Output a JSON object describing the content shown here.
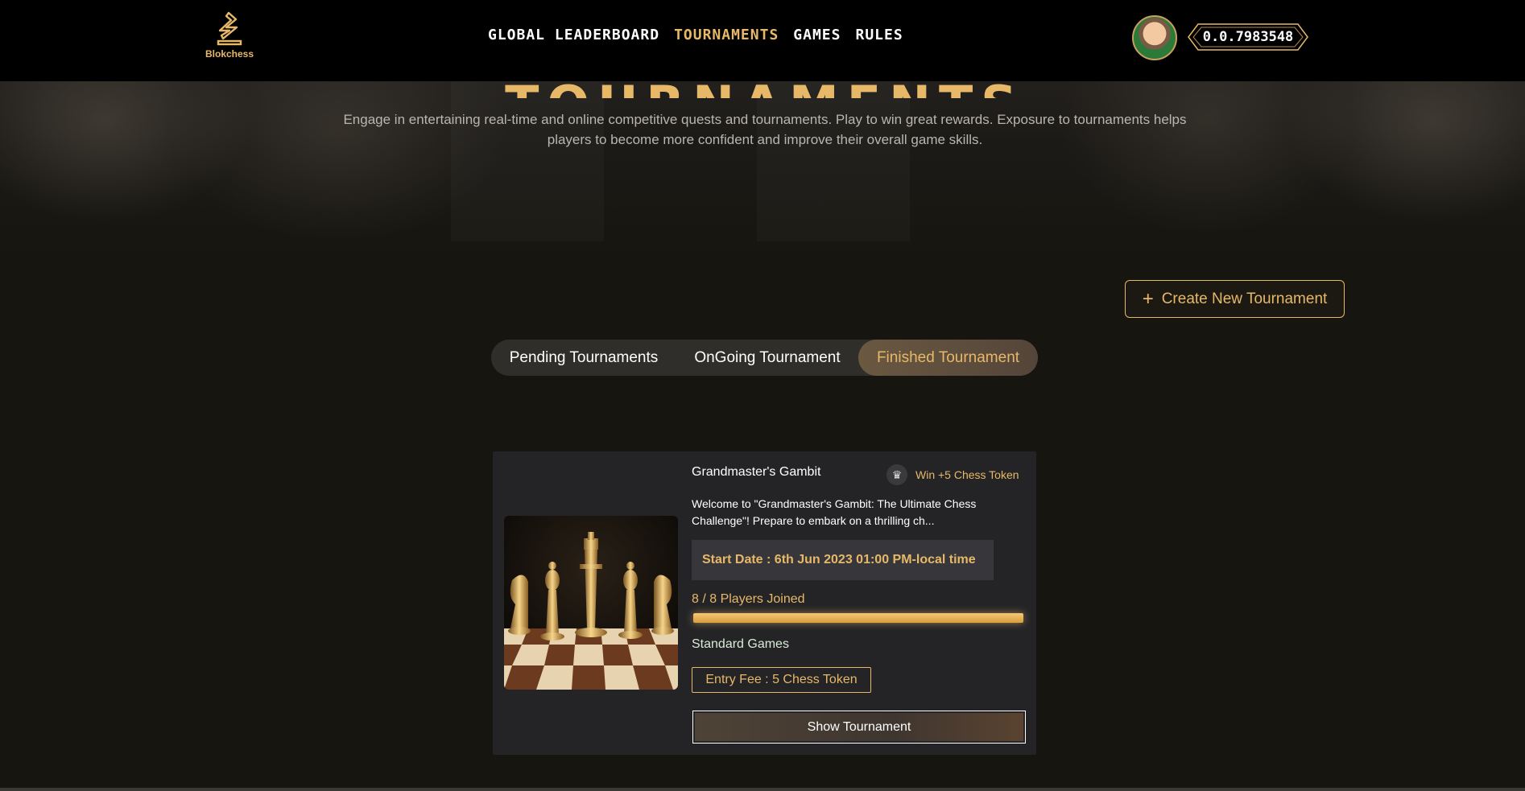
{
  "brand": {
    "name": "Blokchess"
  },
  "nav": {
    "links": [
      {
        "label": "Global Leaderboard",
        "active": false
      },
      {
        "label": "Tournaments",
        "active": true
      },
      {
        "label": "Games",
        "active": false
      },
      {
        "label": "Rules",
        "active": false
      }
    ],
    "balance": "0.0.7983548"
  },
  "hero": {
    "title": "WELCOME TO THE TOURNAMENTS",
    "description": "Engage in entertaining real-time and online competitive quests and tournaments. Play to win great rewards. Exposure to tournaments helps players to become more confident and improve their overall game skills."
  },
  "actions": {
    "create_label": "Create New Tournament"
  },
  "tabs": [
    {
      "label": "Pending Tournaments",
      "active": false
    },
    {
      "label": "OnGoing Tournament",
      "active": false
    },
    {
      "label": "Finished Tournament",
      "active": true
    }
  ],
  "card": {
    "title": "Grandmaster's Gambit",
    "reward": "Win +5 Chess Token",
    "description": "Welcome to \"Grandmaster's Gambit: The Ultimate Chess Challenge\"! Prepare to embark on a thrilling ch...",
    "start_date": "Start Date : 6th Jun 2023 01:00 PM-local time",
    "players": "8 / 8 Players Joined",
    "players_fraction": 1.0,
    "game_type": "Standard Games",
    "entry_fee": "Entry Fee : 5 Chess Token",
    "show_label": "Show Tournament"
  },
  "colors": {
    "accent": "#e7b868",
    "background": "#16150f",
    "card": "#242427"
  }
}
